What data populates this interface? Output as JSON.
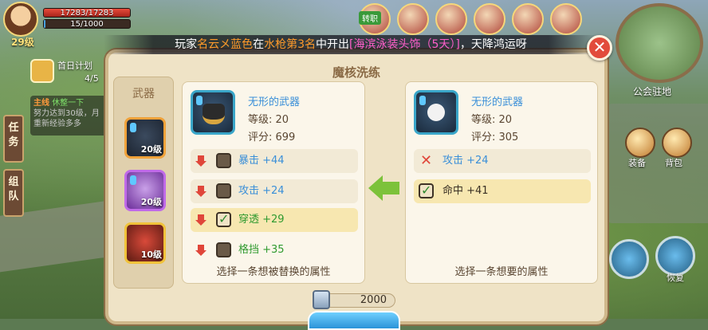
{
  "hud": {
    "player_level": "29级",
    "hp_text": "17283/17283",
    "mp_text": "15/1000",
    "plan_label": "首日计划",
    "plan_count": "4/5",
    "quest": {
      "tag": "主线",
      "name": "休整一下",
      "line1": "努力达到30级，月",
      "line2": "重新经验多多"
    },
    "tabs": [
      "任务",
      "组队"
    ],
    "kill_badge": "转职",
    "guild_label": "公会驻地",
    "right_buttons": [
      "装备",
      "背包"
    ],
    "recover_label": "恢复"
  },
  "announcement": {
    "prefix": "玩家",
    "player": "名云メ蓝色",
    "mid1": "在",
    "place": "水枪第3名",
    "mid2": "中开出",
    "item": "[海滨泳装头饰（5天）]",
    "suffix": "，天降鸿运呀"
  },
  "dialog": {
    "title": "魔核洗练",
    "weapon_header": "武器",
    "slots": [
      {
        "level": "20级"
      },
      {
        "level": "20级"
      },
      {
        "level": "10级"
      }
    ],
    "left_panel": {
      "name": "无形的武器",
      "level": "等级: 20",
      "score": "评分: 699",
      "attrs": [
        "暴击 +44",
        "攻击 +24",
        "穿透 +29",
        "格挡 +35"
      ],
      "hint": "选择一条想被替换的属性"
    },
    "right_panel": {
      "name": "无形的武器",
      "level": "等级: 20",
      "score": "评分: 305",
      "attrs": [
        "攻击 +24",
        "命中 +41"
      ],
      "hint": "选择一条想要的属性"
    },
    "cost": "2000"
  }
}
